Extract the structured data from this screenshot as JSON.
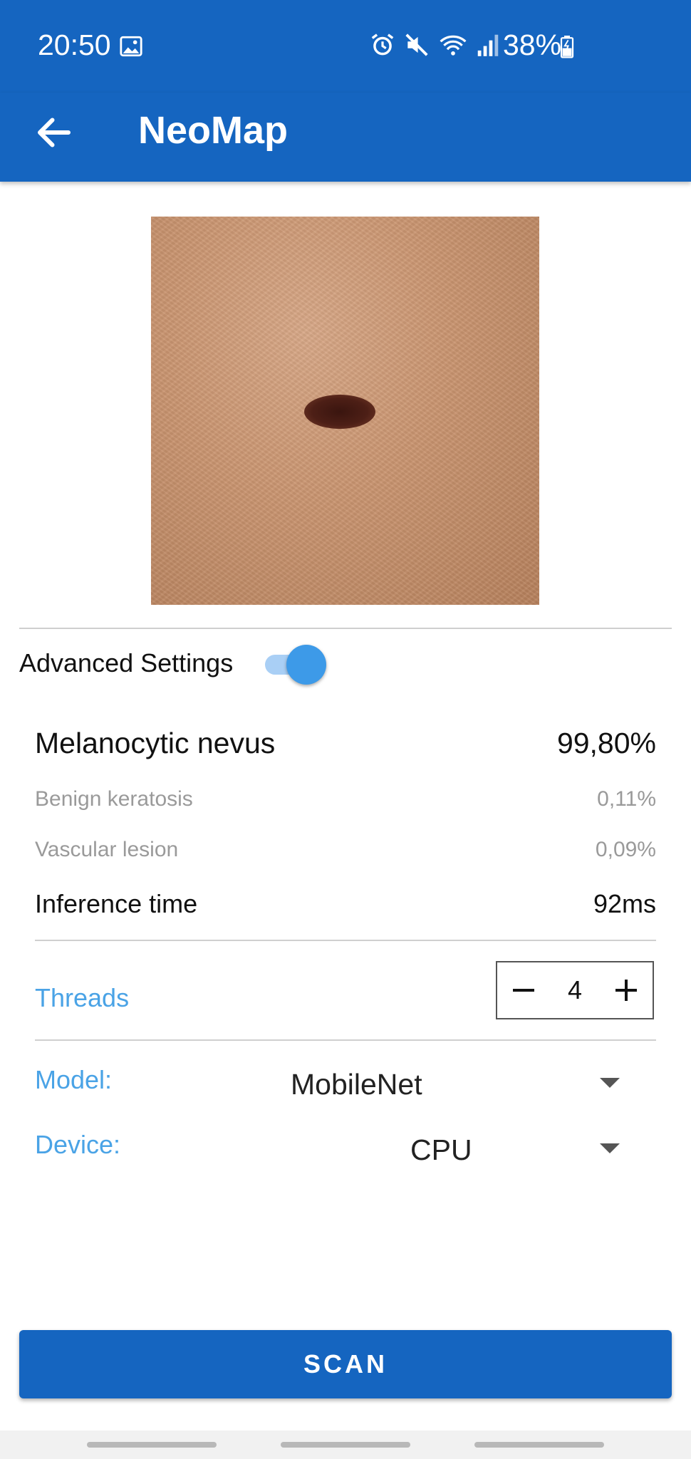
{
  "status_bar": {
    "time": "20:50",
    "battery": "38%",
    "icons": [
      "gallery-icon",
      "alarm-icon",
      "mute-icon",
      "wifi-icon",
      "signal-icon",
      "battery-charging-icon"
    ]
  },
  "app_bar": {
    "title": "NeoMap",
    "back_icon": "arrow-back-icon",
    "color": "#1565c0"
  },
  "advanced_settings": {
    "label": "Advanced Settings",
    "enabled": true
  },
  "results": [
    {
      "label": "Melanocytic nevus",
      "value": "99,80%"
    },
    {
      "label": "Benign keratosis",
      "value": "0,11%"
    },
    {
      "label": "Vascular lesion",
      "value": "0,09%"
    }
  ],
  "inference": {
    "label": "Inference time",
    "value": "92ms"
  },
  "threads": {
    "label": "Threads",
    "value": "4"
  },
  "model": {
    "label": "Model:",
    "value": "MobileNet"
  },
  "device": {
    "label": "Device:",
    "value": "CPU"
  },
  "scan_button": {
    "label": "SCAN"
  },
  "colors": {
    "accent": "#4aa3e6",
    "primary": "#1565c0",
    "secondary_text": "#9a9a9a"
  }
}
